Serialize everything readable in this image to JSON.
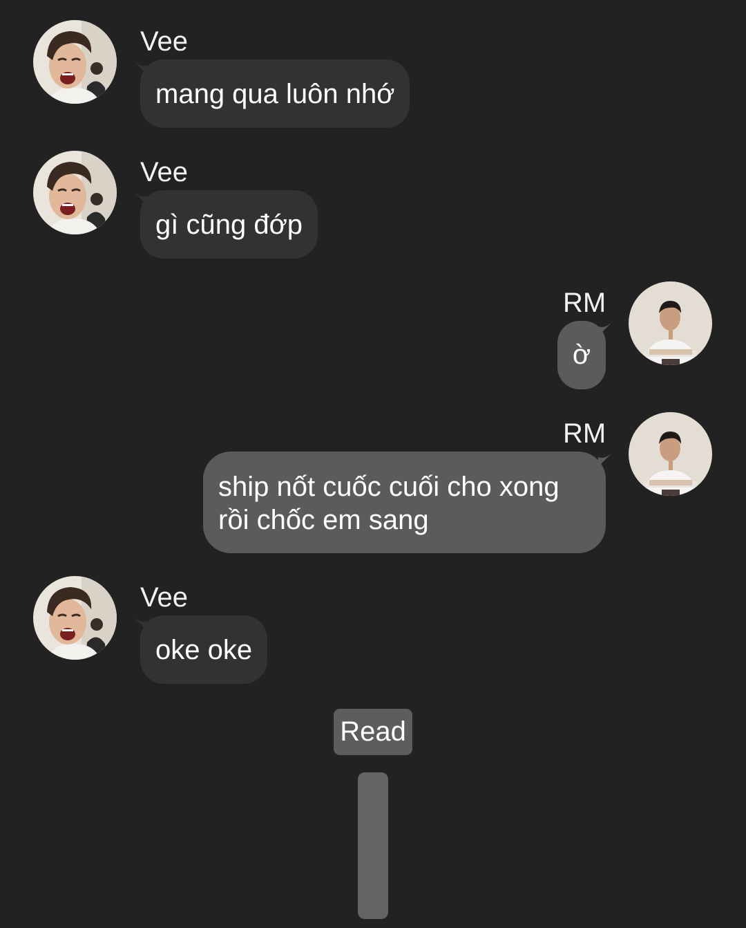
{
  "messages": [
    {
      "sender": "Vee",
      "text": "mang qua luôn nhớ",
      "direction": "incoming"
    },
    {
      "sender": "Vee",
      "text": "gì cũng đớp",
      "direction": "incoming"
    },
    {
      "sender": "RM",
      "text": "ờ",
      "direction": "outgoing"
    },
    {
      "sender": "RM",
      "lines": [
        "ship nốt cuốc cuối cho xong",
        "rồi chốc em sang"
      ],
      "direction": "outgoing"
    },
    {
      "sender": "Vee",
      "text": "oke oke",
      "direction": "incoming"
    }
  ],
  "status": {
    "read_label": "Read"
  },
  "colors": {
    "background": "#222222",
    "incoming_bubble": "#323232",
    "outgoing_bubble": "#5b5b5b",
    "read_badge": "#5d5d5d"
  },
  "icons": {
    "vee_avatar": "vee-avatar-photo",
    "rm_avatar": "rm-avatar-photo"
  }
}
